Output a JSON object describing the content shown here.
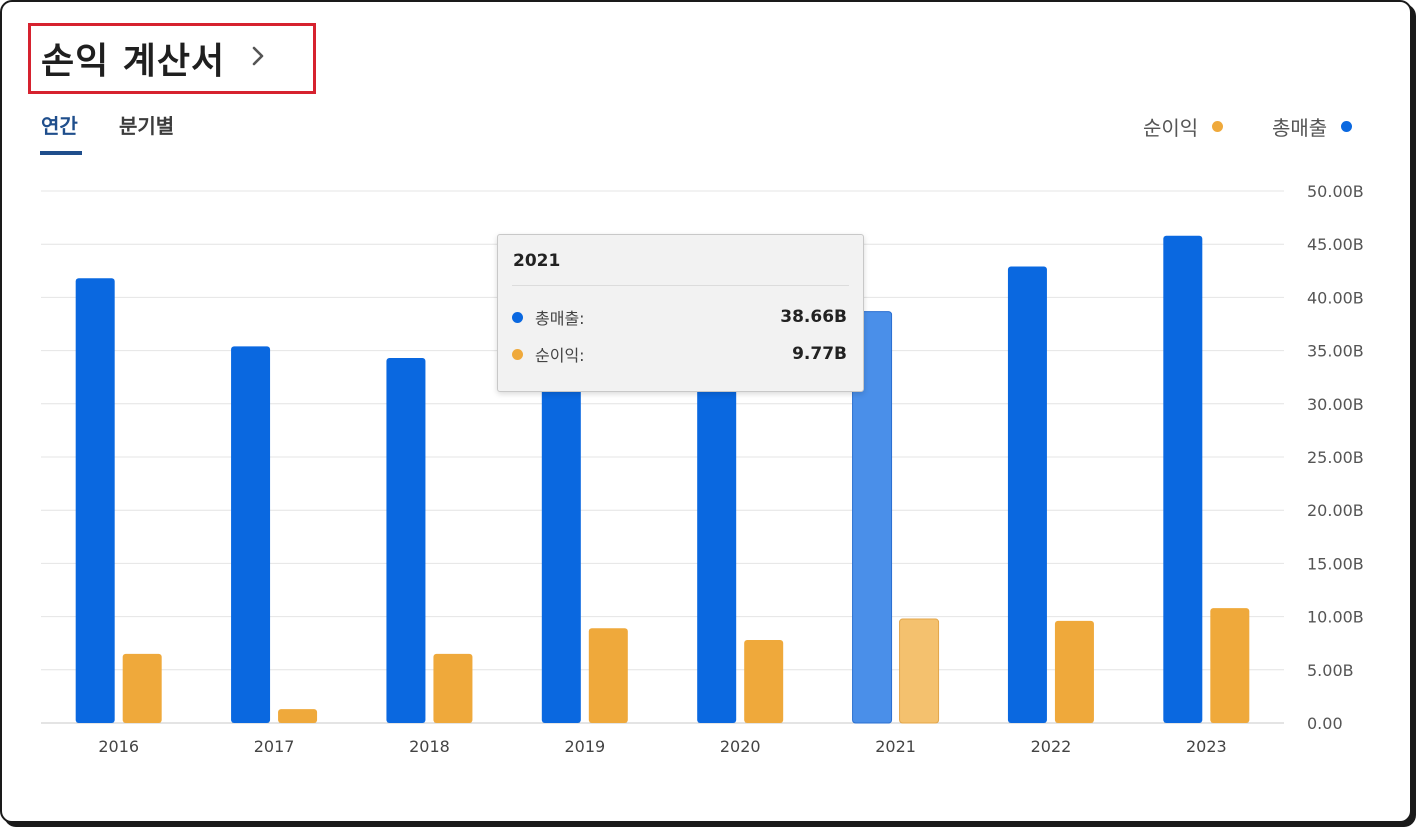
{
  "header": {
    "title": "손익 계산서",
    "chevron_icon": "chevron-right-icon"
  },
  "tabs": [
    {
      "label": "연간",
      "active": true
    },
    {
      "label": "분기별",
      "active": false
    }
  ],
  "legend": [
    {
      "label": "순이익",
      "color": "#efa93b"
    },
    {
      "label": "총매출",
      "color": "#0a68e0"
    }
  ],
  "tooltip": {
    "year": "2021",
    "rows": [
      {
        "label": "총매출:",
        "value": "38.66B",
        "color": "#0a68e0"
      },
      {
        "label": "순이익:",
        "value": "9.77B",
        "color": "#efa93b"
      }
    ]
  },
  "colors": {
    "revenue": "#0a68e0",
    "net_income": "#efa93b",
    "highlight_revenue": "#4a8fe9",
    "highlight_net_income": "#f4c16e"
  },
  "chart_data": {
    "type": "bar",
    "categories": [
      "2016",
      "2017",
      "2018",
      "2019",
      "2020",
      "2021",
      "2022",
      "2023"
    ],
    "series": [
      {
        "name": "총매출",
        "values": [
          41.8,
          35.4,
          34.3,
          32.0,
          32.0,
          38.66,
          42.9,
          45.8
        ]
      },
      {
        "name": "순이익",
        "values": [
          6.5,
          1.3,
          6.5,
          8.9,
          7.8,
          9.77,
          9.6,
          10.8
        ]
      }
    ],
    "ylim": [
      0,
      50
    ],
    "y_ticks": [
      "0.00",
      "5.00B",
      "10.00B",
      "15.00B",
      "20.00B",
      "25.00B",
      "30.00B",
      "35.00B",
      "40.00B",
      "45.00B",
      "50.00B"
    ],
    "y_axis_position": "right",
    "grid": true,
    "highlighted_category": "2021",
    "legend_position": "top-right"
  }
}
